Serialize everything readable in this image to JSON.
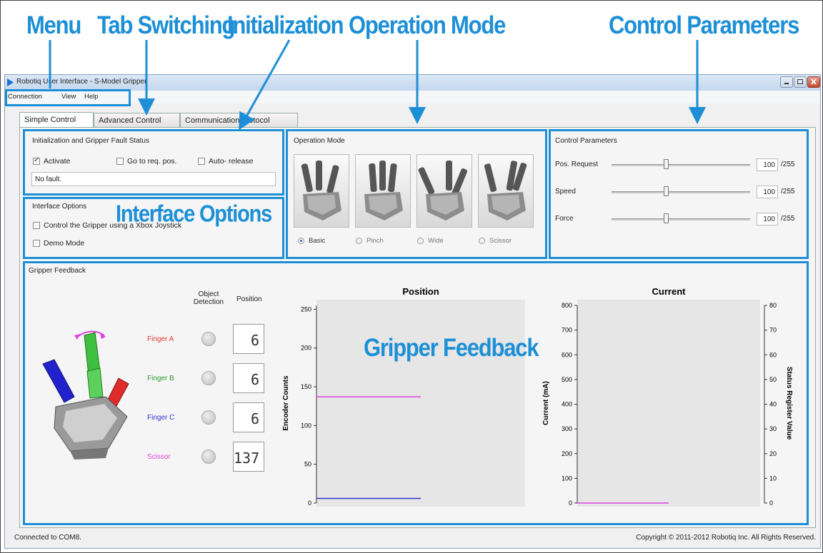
{
  "callouts": {
    "menu": "Menu",
    "tab_switching": "Tab Switching",
    "initialization": "Initialization",
    "operation_mode": "Operation Mode",
    "control_parameters": "Control Parameters",
    "interface_options": "Interface Options",
    "gripper_feedback": "Gripper Feedback"
  },
  "window": {
    "title": "Robotiq User Interface - S-Model Gripper"
  },
  "menu": [
    "Connection",
    "View",
    "Help"
  ],
  "tabs": [
    {
      "label": "Simple Control",
      "active": true
    },
    {
      "label": "Advanced Control",
      "active": false
    },
    {
      "label": "Communication protocol",
      "active": false
    }
  ],
  "init": {
    "title": "Initialization and Gripper Fault Status",
    "activate": {
      "label": "Activate",
      "checked": true
    },
    "goto": {
      "label": "Go to req. pos.",
      "checked": false
    },
    "auto_release": {
      "label": "Auto- release",
      "checked": false
    },
    "fault_text": "No fault."
  },
  "interface_options": {
    "title": "Interface Options",
    "joystick": {
      "label": "Control the Gripper using a Xbox Joystick",
      "checked": false
    },
    "demo": {
      "label": "Demo Mode",
      "checked": false
    }
  },
  "operation_mode": {
    "title": "Operation Mode",
    "modes": [
      {
        "label": "Basic",
        "selected": true
      },
      {
        "label": "Pinch",
        "selected": false
      },
      {
        "label": "Wide",
        "selected": false
      },
      {
        "label": "Scissor",
        "selected": false
      }
    ]
  },
  "control_parameters": {
    "title": "Control Parameters",
    "rows": [
      {
        "label": "Pos. Request",
        "value": "100",
        "max": "/255",
        "level": 0.392
      },
      {
        "label": "Speed",
        "value": "100",
        "max": "/255",
        "level": 0.392
      },
      {
        "label": "Force",
        "value": "100",
        "max": "/255",
        "level": 0.392
      }
    ]
  },
  "feedback": {
    "title": "Gripper Feedback",
    "col_object_detection": "Object Detection",
    "col_position": "Position",
    "fingers": [
      {
        "label": "Finger A",
        "color": "#e53935",
        "position": "6"
      },
      {
        "label": "Finger B",
        "color": "#2e9b2e",
        "position": "6"
      },
      {
        "label": "Finger C",
        "color": "#3333cc",
        "position": "6"
      },
      {
        "label": "Scissor",
        "color": "#e040e0",
        "position": "137"
      }
    ]
  },
  "chart_data": [
    {
      "type": "line",
      "title": "Position",
      "ylabel": "Encoder Counts",
      "ylim": [
        0,
        255
      ],
      "yticks": [
        0,
        50,
        100,
        150,
        200,
        250
      ],
      "series": [
        {
          "color": "#e040e0",
          "values": [
            137,
            137
          ]
        },
        {
          "color": "#3333cc",
          "values": [
            6,
            6
          ]
        }
      ]
    },
    {
      "type": "line",
      "title": "Current",
      "ylabel": "Current (mA)",
      "y2label": "Status Register Value",
      "ylim": [
        0,
        800
      ],
      "y2lim": [
        0,
        80
      ],
      "yticks": [
        0,
        100,
        200,
        300,
        400,
        500,
        600,
        700,
        800
      ],
      "y2ticks": [
        0,
        10,
        20,
        30,
        40,
        50,
        60,
        70,
        80
      ],
      "series": [
        {
          "color": "#e040e0",
          "values": [
            0,
            0
          ]
        }
      ]
    }
  ],
  "status": {
    "connection": "Connected to COM8.",
    "copyright": "Copyright © 2011-2012 Robotiq Inc. All Rights Reserved."
  }
}
